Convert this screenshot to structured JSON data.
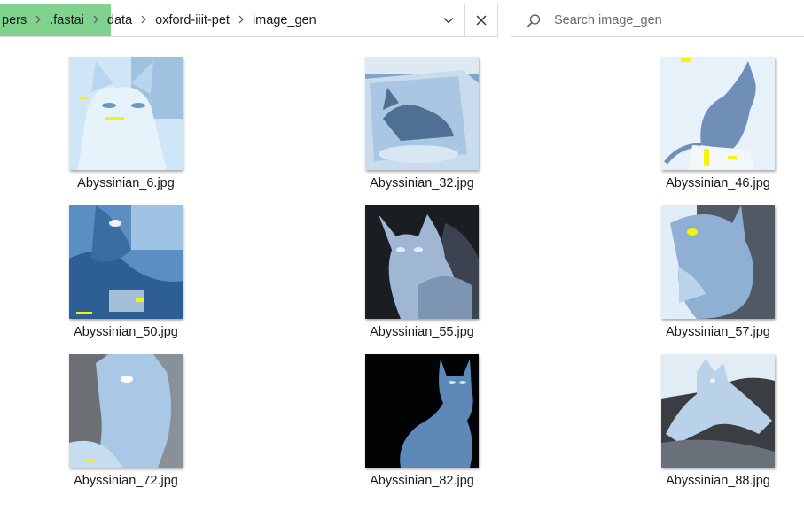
{
  "address": {
    "crumbs": [
      "pers",
      ".fastai",
      "data",
      "oxford-iiit-pet",
      "image_gen"
    ],
    "separator_icon": "chevron-right-icon",
    "dropdown_icon": "chevron-down-icon",
    "close_icon": "close-icon",
    "highlight_color": "#7fd38d"
  },
  "search": {
    "placeholder": "Search image_gen",
    "value": "",
    "icon": "search-icon"
  },
  "files": [
    {
      "name": "Abyssinian_6.jpg"
    },
    {
      "name": "Abyssinian_32.jpg"
    },
    {
      "name": "Abyssinian_46.jpg"
    },
    {
      "name": "Abyssinian_50.jpg"
    },
    {
      "name": "Abyssinian_55.jpg"
    },
    {
      "name": "Abyssinian_57.jpg"
    },
    {
      "name": "Abyssinian_72.jpg"
    },
    {
      "name": "Abyssinian_82.jpg"
    },
    {
      "name": "Abyssinian_88.jpg"
    }
  ]
}
